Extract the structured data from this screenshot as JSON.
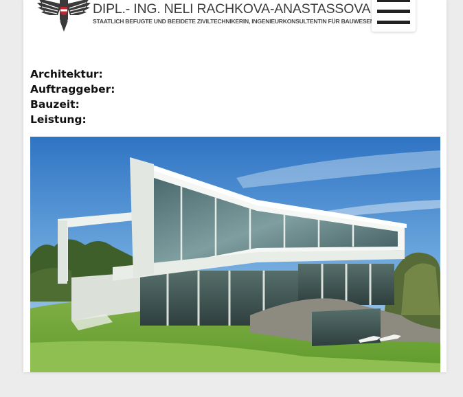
{
  "header": {
    "title": "DIPL.- ING. NELI RACHKOVA-ANASTASSOVA",
    "subtitle": "STAATLICH BEFUGTE UND BEEIDETE ZIVILTECHNIKERIN, INGENIEURKONSULTENTIN FÜR BAUWESEN",
    "logo_icon": "eagle-crest-icon",
    "menu_icon": "hamburger-menu-icon"
  },
  "project": {
    "architektur_label": "Architektur:",
    "auftraggeber_label": "Auftraggeber:",
    "bauzeit_label": "Bauzeit:",
    "leistung_label": "Leistung:"
  },
  "image": {
    "subject": "modern-villa-rendering"
  },
  "colors": {
    "page_bg": "#ffffff",
    "outer_bg": "#ececec",
    "text": "#111111",
    "logo_text": "#3c3c3c",
    "logo_red": "#c0262d"
  }
}
